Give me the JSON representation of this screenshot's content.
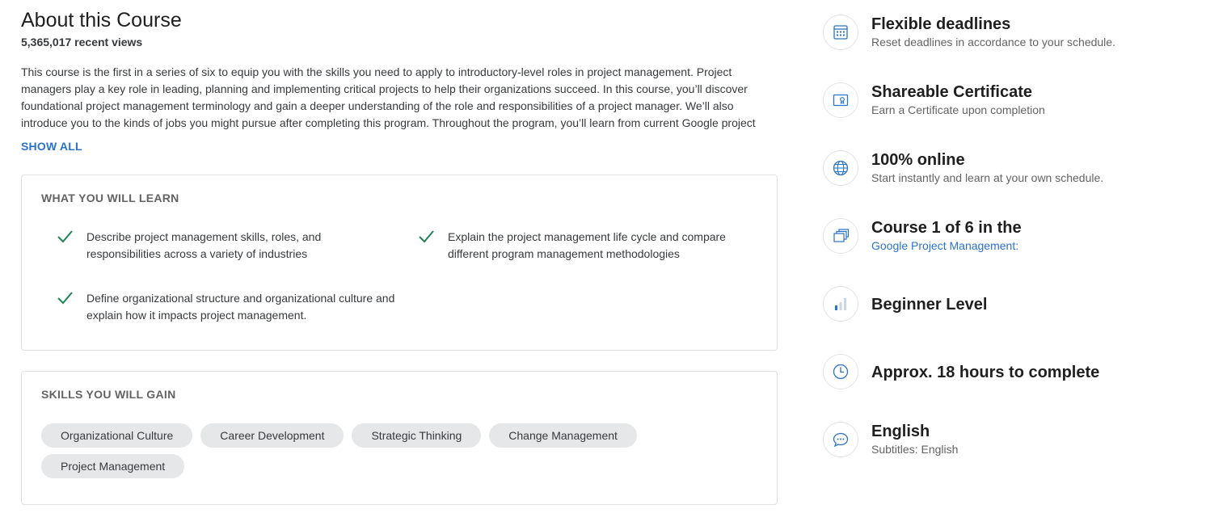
{
  "about": {
    "title": "About this Course",
    "views": "5,365,017 recent views",
    "description": "This course is the first in a series of six to equip you with the skills you need to apply to introductory-level roles in project management. Project managers play a key role in leading, planning and implementing critical projects to help their organizations succeed. In this course, you’ll discover foundational project management terminology and gain a deeper understanding of  the role and responsibilities of a project manager. We’ll also introduce you to the kinds of jobs you might pursue after completing this program. Throughout the program, you’ll learn from current Google project managers, who can provide you with a multi-dimensional educational experience that will help you build your skills  for",
    "show_all": "SHOW ALL"
  },
  "learn": {
    "heading": "WHAT YOU WILL LEARN",
    "items": [
      "Describe project management skills, roles, and responsibilities across a variety of industries",
      "Explain the project management life cycle and compare different program management methodologies",
      "Define organizational structure and organizational culture and explain how it impacts project management."
    ]
  },
  "skills": {
    "heading": "SKILLS YOU WILL GAIN",
    "chips": [
      "Organizational Culture",
      "Career Development",
      "Strategic Thinking",
      "Change Management",
      "Project Management"
    ]
  },
  "features": [
    {
      "icon": "calendar-icon",
      "title": "Flexible deadlines",
      "subtitle": "Reset deadlines in accordance to your schedule."
    },
    {
      "icon": "certificate-icon",
      "title": "Shareable Certificate",
      "subtitle": "Earn a Certificate upon completion"
    },
    {
      "icon": "globe-icon",
      "title": "100% online",
      "subtitle": "Start instantly and learn at your own schedule."
    },
    {
      "icon": "stacked-cards-icon",
      "title": "Course 1 of 6 in the",
      "subtitle": "Google Project Management:"
    },
    {
      "icon": "level-bars-icon",
      "title": "Beginner Level",
      "subtitle": ""
    },
    {
      "icon": "clock-icon",
      "title": "Approx. 18 hours to complete",
      "subtitle": ""
    },
    {
      "icon": "chat-icon",
      "title": "English",
      "subtitle": "Subtitles: English"
    }
  ],
  "colors": {
    "link": "#2a73cc",
    "check": "#1f8354",
    "chip_bg": "#e5e7e8",
    "icon": "#2a73cc"
  }
}
